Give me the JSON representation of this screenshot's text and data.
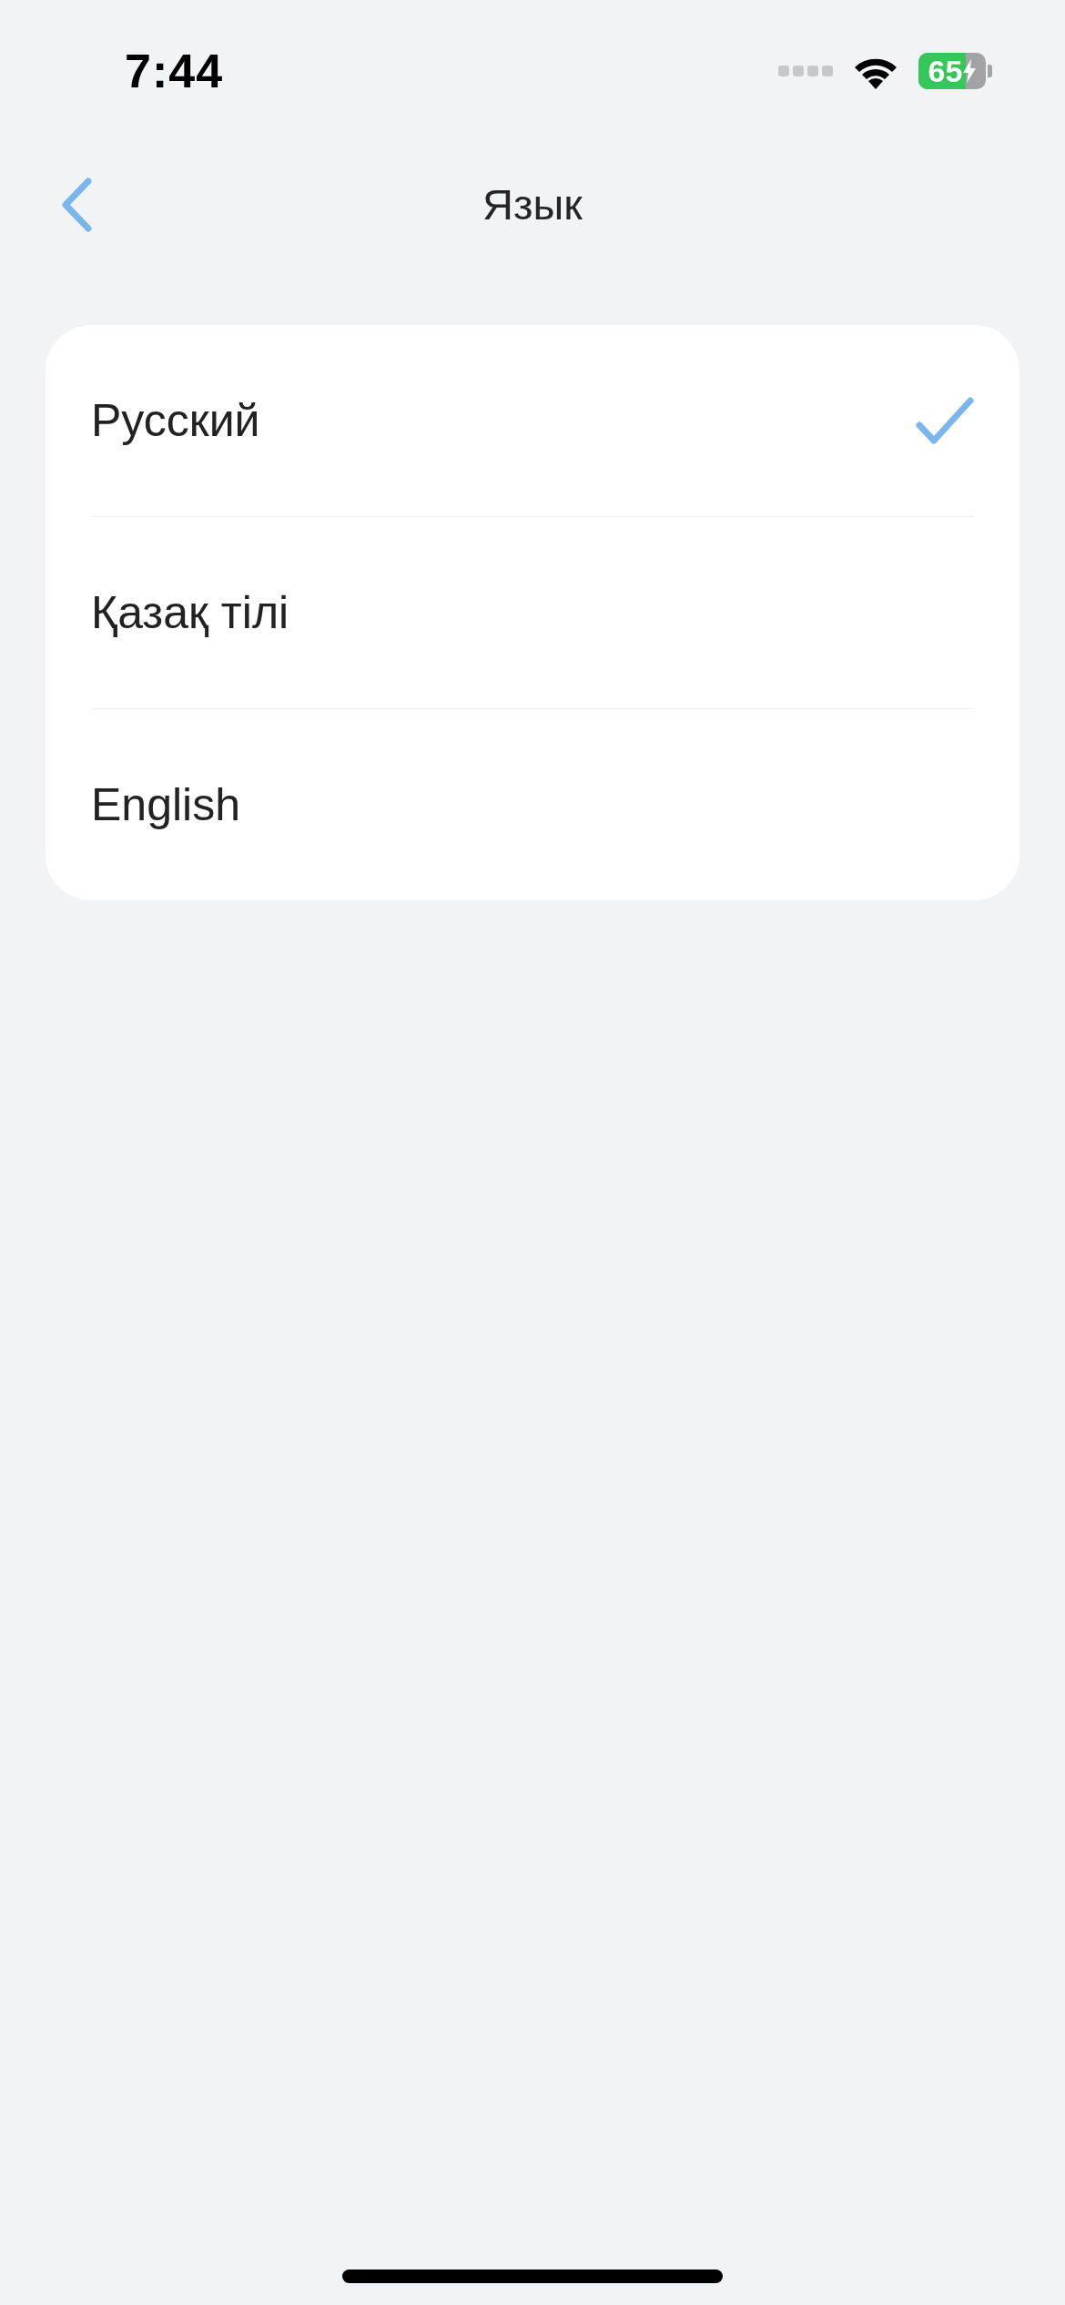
{
  "status_bar": {
    "time": "7:44",
    "battery": "65"
  },
  "nav": {
    "title": "Язык"
  },
  "languages": [
    {
      "label": "Русский",
      "selected": true
    },
    {
      "label": "Қазақ тілі",
      "selected": false
    },
    {
      "label": "English",
      "selected": false
    }
  ]
}
